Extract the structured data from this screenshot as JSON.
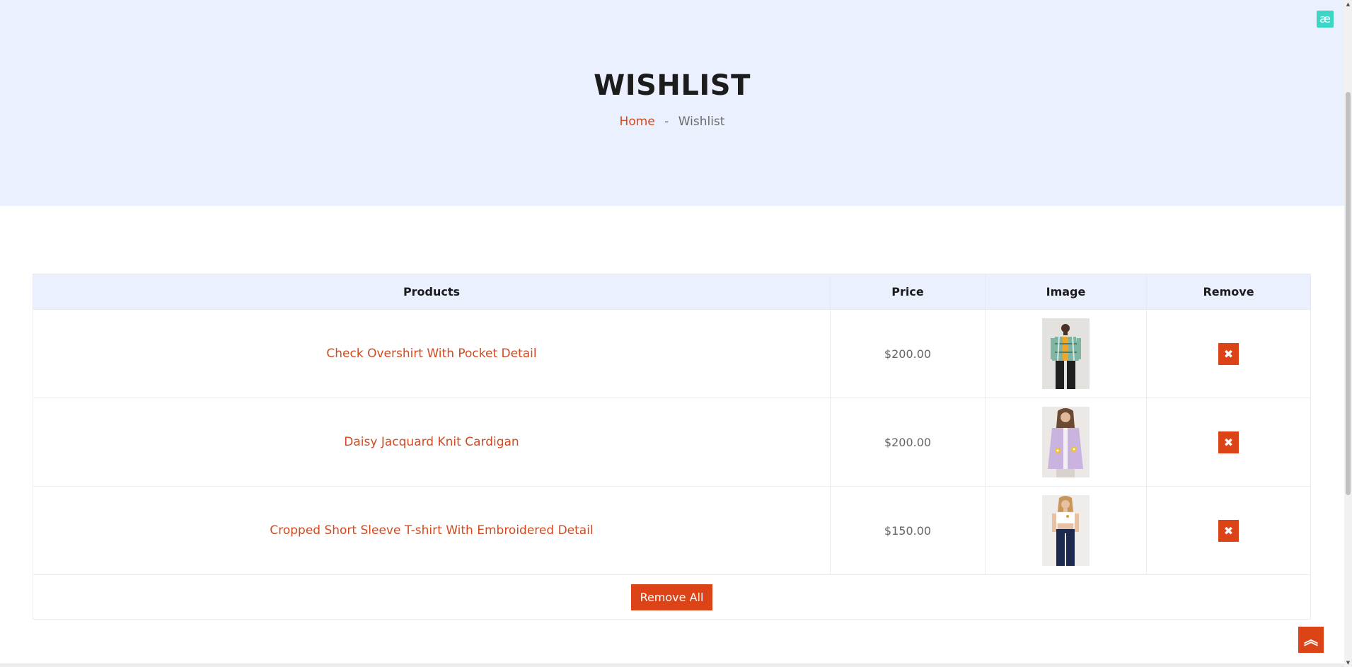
{
  "hero": {
    "title": "WISHLIST",
    "breadcrumb": {
      "home": "Home",
      "separator": "-",
      "current": "Wishlist"
    }
  },
  "badge": {
    "text": "æ",
    "color": "#3dd6c6"
  },
  "table": {
    "headers": {
      "products": "Products",
      "price": "Price",
      "image": "Image",
      "remove": "Remove"
    },
    "rows": [
      {
        "product": "Check Overshirt With Pocket Detail",
        "price": "$200.00",
        "image": "man-plaid-overshirt-photo"
      },
      {
        "product": "Daisy Jacquard Knit Cardigan",
        "price": "$200.00",
        "image": "woman-lilac-cardigan-photo"
      },
      {
        "product": "Cropped Short Sleeve T-shirt With Embroidered Detail",
        "price": "$150.00",
        "image": "woman-white-tshirt-photo"
      }
    ],
    "remove_icon": "close-icon",
    "remove_all_label": "Remove All"
  },
  "scroll_top": {
    "icon": "double-chevron-up-icon"
  },
  "colors": {
    "accent": "#dc4316",
    "link": "#d24a1f",
    "hero_bg": "#ebf0fe"
  }
}
